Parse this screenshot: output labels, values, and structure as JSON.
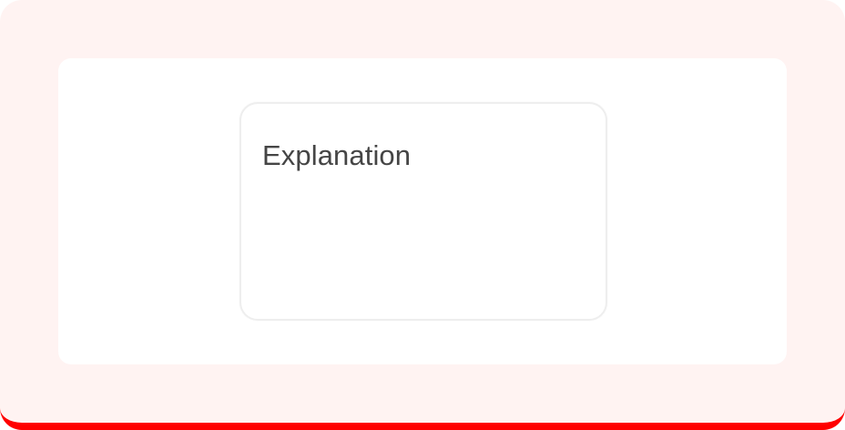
{
  "card": {
    "label": "Explanation"
  },
  "colors": {
    "frame_background": "#fff3f2",
    "accent_bottom_border": "#ff0000",
    "panel_background": "#ffffff",
    "card_border": "#eeeeee",
    "text": "#454545"
  }
}
